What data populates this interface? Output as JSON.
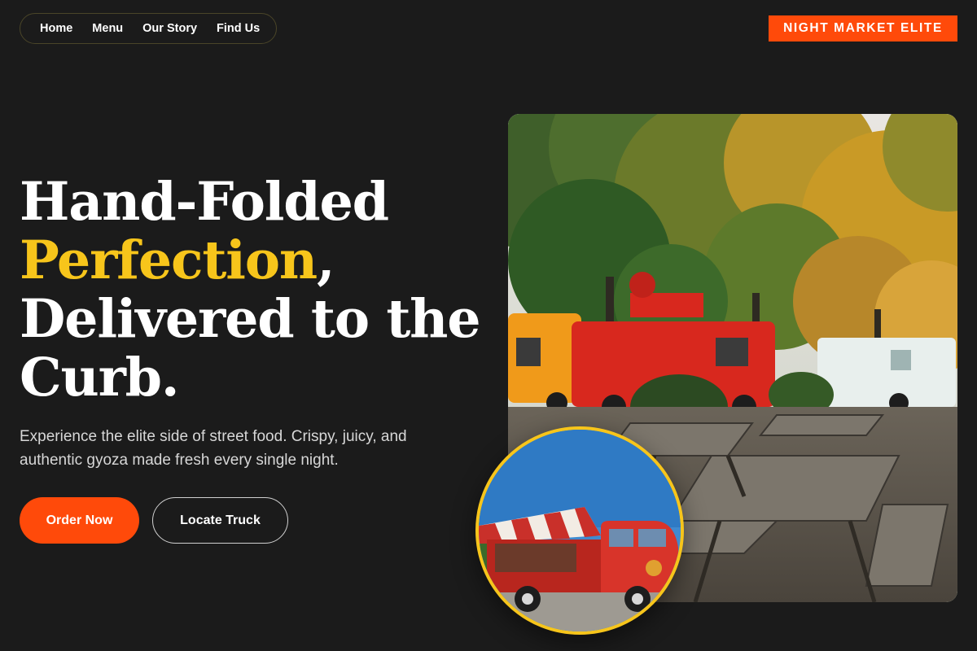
{
  "nav": {
    "items": [
      {
        "label": "Home"
      },
      {
        "label": "Menu"
      },
      {
        "label": "Our Story"
      },
      {
        "label": "Find Us"
      }
    ]
  },
  "brand": {
    "label": "NIGHT MARKET ELITE"
  },
  "hero": {
    "headline_line1": "Hand-Folded",
    "headline_accent": "Perfection",
    "headline_comma": ",",
    "headline_line3": "Delivered to the",
    "headline_line4": "Curb.",
    "subtext": "Experience the elite side of street food. Crispy, juicy, and authentic gyoza made fresh every single night.",
    "primary_button": "Order Now",
    "secondary_button": "Locate Truck"
  },
  "images": {
    "main_photo": "food-trucks-park-photo",
    "circle_photo": "vintage-food-van-photo"
  },
  "colors": {
    "background": "#1b1b1b",
    "accent_orange": "#ff4a0a",
    "accent_yellow": "#f7c51b",
    "text_primary": "#ffffff",
    "text_secondary": "#d7d7d7"
  }
}
